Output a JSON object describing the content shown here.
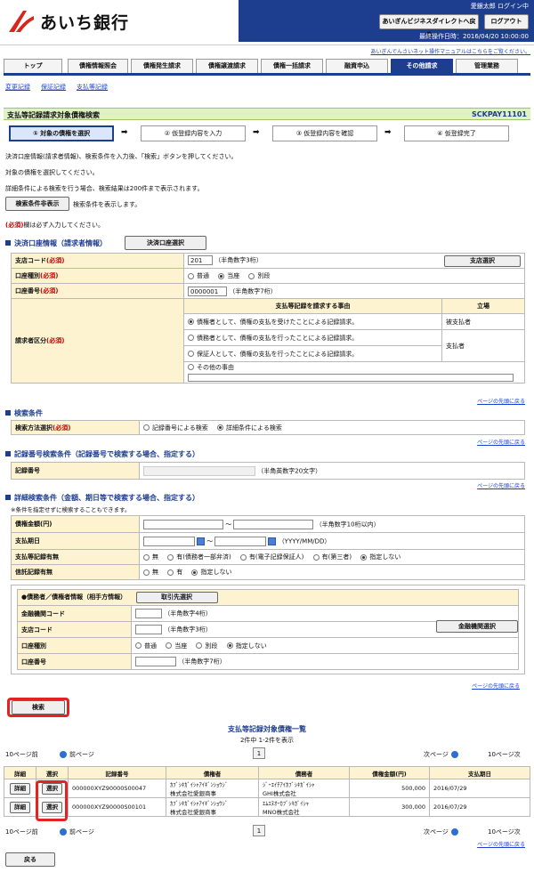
{
  "header": {
    "logo_text": "あいち銀行",
    "user": "愛銀太郎 ログイン中",
    "direct_button": "あいぎんビジネスダイレクトへ戻る",
    "logout_button": "ログアウト",
    "last_op": "最終操作日時：2016/04/20 10:00:00",
    "manual_link": "あいぎんでんさいネット操作マニュアルはこちらをご覧ください。"
  },
  "tabs": [
    "トップ",
    "債権情報照会",
    "債権発生請求",
    "債権譲渡請求",
    "債権一括請求",
    "融資申込",
    "その他請求",
    "管理業務"
  ],
  "sublinks": [
    "変更記録",
    "保証記録",
    "支払等記録"
  ],
  "page": {
    "title": "支払等記録請求対象債権検索",
    "screen_id": "SCKPAY11101"
  },
  "steps": [
    "① 対象の債権を選択",
    "② 仮登録内容を入力",
    "③ 仮登録内容を確認",
    "④ 仮登録完了"
  ],
  "instructions": [
    "決済口座情報(請求者情報)、検索条件を入力後、「検索」ボタンを押してください。",
    "対象の債権を選択してください。",
    "詳細条件による検索を行う場合、検索結果は200件まで表示されます。"
  ],
  "toggle_button": "検索条件非表示",
  "toggle_note": "検索条件を表示します。",
  "required_note_mark": "(必須)",
  "required_note": "欄は必ず入力してください。",
  "account_section": {
    "title": "決済口座情報（請求者情報）",
    "select_button": "決済口座選択",
    "branch_label": "支店コード",
    "branch_value": "201",
    "branch_hint": "（半角数字3桁）",
    "branch_button": "支店選択",
    "type_label": "口座種別",
    "type_options": [
      "普通",
      "当座",
      "別段"
    ],
    "number_label": "口座番号",
    "number_value": "0000001",
    "number_hint": "（半角数字7桁）",
    "requester_label": "請求者区分",
    "reason_header": "支払等記録を請求する事由",
    "position_header": "立場",
    "reasons": [
      "債権者として、債権の支払を受けたことによる記録請求。",
      "債務者として、債権の支払を行ったことによる記録請求。",
      "保証人として、債権の支払を行ったことによる記録請求。",
      "その他の事由"
    ],
    "positions": [
      "被支払者",
      "支払者"
    ]
  },
  "required_mark": "(必須)",
  "top_link": "ページの先頭に戻る",
  "search_section": {
    "title": "検索条件",
    "method_label": "検索方法選択",
    "methods": [
      "記録番号による検索",
      "詳細条件による検索"
    ]
  },
  "record_section": {
    "title": "記録番号検索条件（記録番号で検索する場合、指定する）",
    "label": "記録番号",
    "hint": "（半角英数字20文字）"
  },
  "detail_section": {
    "title": "詳細検索条件（金額、期日等で検索する場合、指定する）",
    "note": "※条件を指定せずに検索することもできます。",
    "amount_label": "債権金額(円)",
    "amount_hint": "（半角数字10桁以内）",
    "due_label": "支払期日",
    "due_hint": "（YYYY/MM/DD）",
    "record_label": "支払等記録有無",
    "record_options": [
      "無",
      "有(債務者一部弁済)",
      "有(電子記録保証人)",
      "有(第三者)",
      "指定しない"
    ],
    "trust_label": "信託記録有無",
    "trust_options": [
      "無",
      "有",
      "指定しない"
    ],
    "party_title": "●債務者／債権者情報（相手方情報）",
    "party_button": "取引先選択",
    "bank_label": "金融機関コード",
    "bank_hint": "（半角数字4桁）",
    "bank_button": "金融機関選択",
    "branch_label": "支店コード",
    "branch_hint": "（半角数字3桁）",
    "type_label": "口座種別",
    "type_options": [
      "普通",
      "当座",
      "別段",
      "指定しない"
    ],
    "number_label": "口座番号",
    "number_hint": "（半角数字7桁）"
  },
  "search_button": "検索",
  "results": {
    "title": "支払等記録対象債権一覧",
    "count": "2件中 1-2件を表示",
    "prev10": "10ページ前",
    "prev": "前ページ",
    "next": "次ページ",
    "next10": "10ページ次",
    "page": "1",
    "headers": [
      "詳細",
      "選択",
      "記録番号",
      "債権者",
      "債務者",
      "債権金額(円)",
      "支払期日"
    ],
    "detail_label": "詳細",
    "select_label": "選択",
    "rows": [
      {
        "record": "000000XYZ90000S00047",
        "creditor_kana": "ｶﾌﾞｼｷｶﾞｲｼｬｱｲｷﾞﾝｼｮｳｼﾞ",
        "creditor": "株式会社愛銀商事",
        "debtor_kana": "ｼﾞｰｴｲﾁｱｲｶﾌﾞｼｷｶﾞｲｼｬ",
        "debtor": "GHI株式会社",
        "amount": "500,000",
        "date": "2016/07/29"
      },
      {
        "record": "000000XYZ90000S00101",
        "creditor_kana": "ｶﾌﾞｼｷｶﾞｲｼｬｱｲｷﾞﾝｼｮｳｼﾞ",
        "creditor": "株式会社愛銀商事",
        "debtor_kana": "ｴﾑｴﾇｵｰｶﾌﾞｼｷｶﾞｲｼｬ",
        "debtor": "MNO株式会社",
        "amount": "300,000",
        "date": "2016/07/29"
      }
    ]
  },
  "back_button": "戻る",
  "colors": {
    "navy": "#1d3d8f",
    "title_bg": "#dff2c2",
    "label_bg": "#fdf3d0",
    "highlight": "#e52222"
  }
}
